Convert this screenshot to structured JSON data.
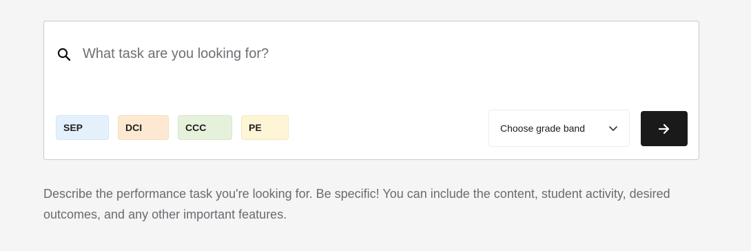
{
  "search": {
    "placeholder": "What task are you looking for?",
    "value": "",
    "icon": "search-icon"
  },
  "tags": [
    {
      "label": "SEP",
      "color": "#e4f1fc"
    },
    {
      "label": "DCI",
      "color": "#fde9d2"
    },
    {
      "label": "CCC",
      "color": "#e6f1dc"
    },
    {
      "label": "PE",
      "color": "#fdf5d6"
    }
  ],
  "grade_band": {
    "label": "Choose grade band",
    "icon": "chevron-down-icon"
  },
  "submit": {
    "icon": "arrow-right-icon",
    "color": "#1a1a1a"
  },
  "helper": {
    "text": "Describe the performance task you're looking for. Be specific! You can include the content, student activity, desired outcomes, and any other important features."
  }
}
